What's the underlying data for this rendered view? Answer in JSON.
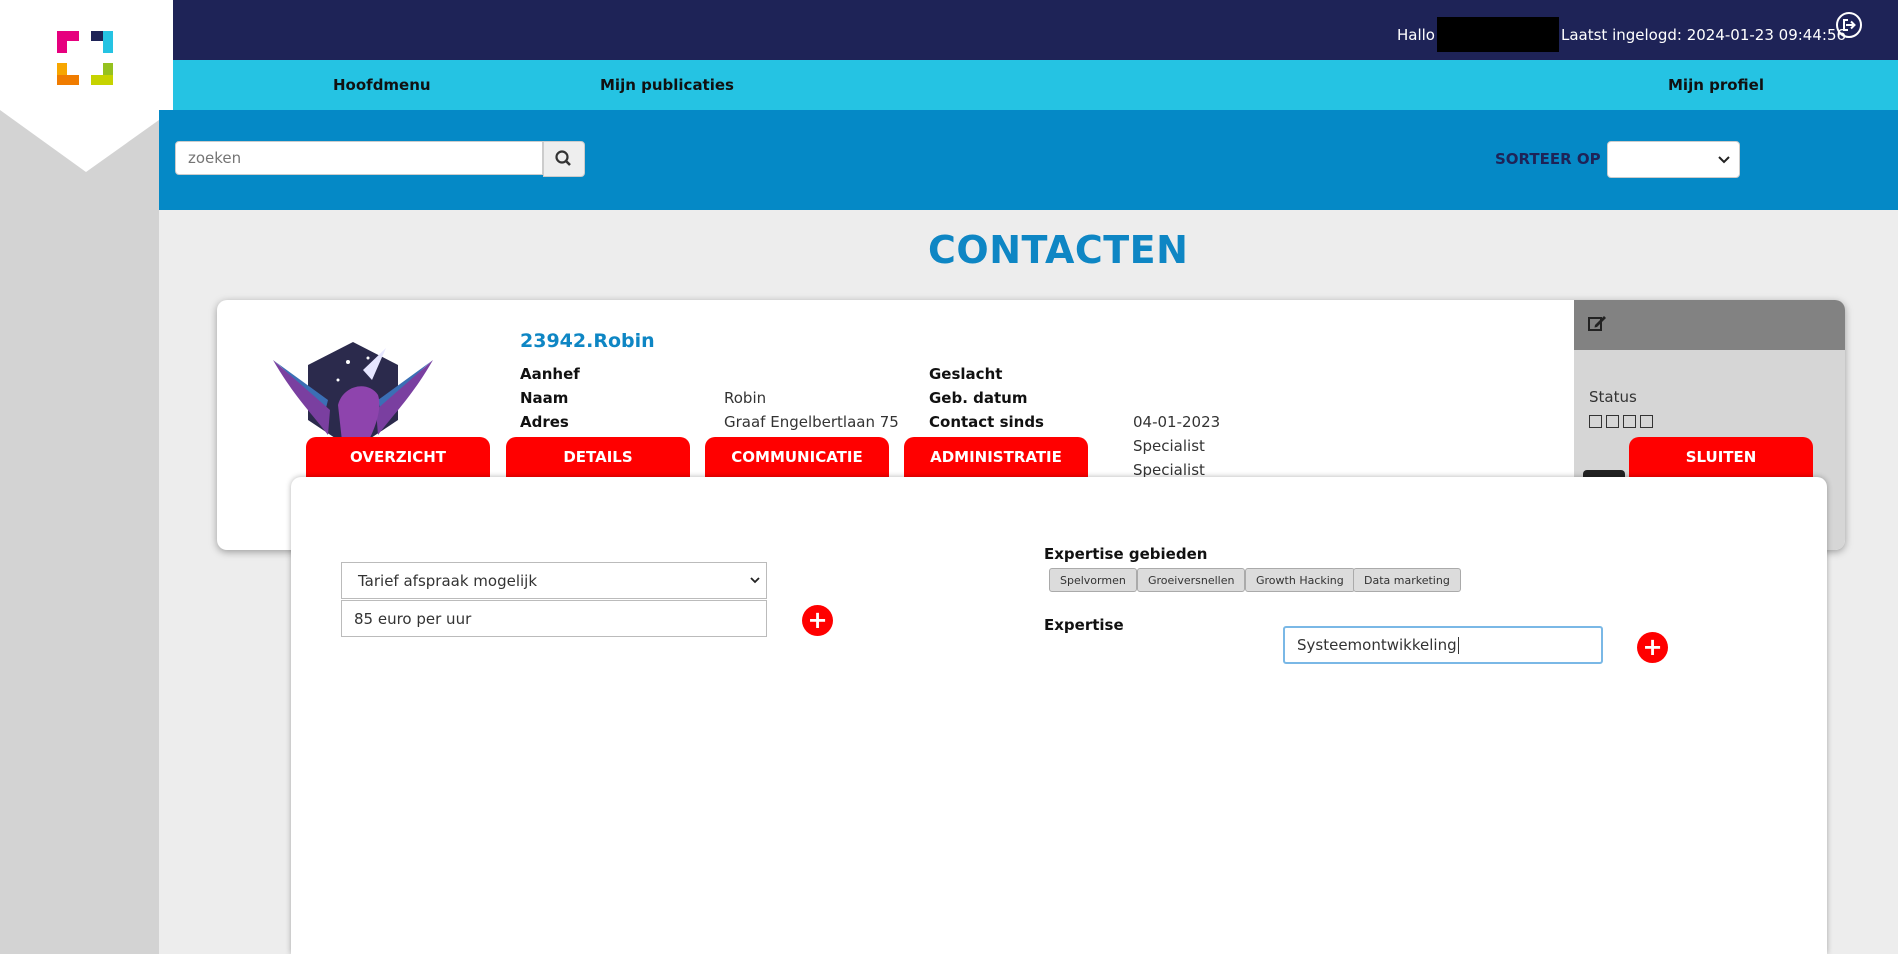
{
  "header": {
    "greeting": "Hallo",
    "last_login": "Laatst ingelogd: 2024-01-23 09:44:56"
  },
  "nav": {
    "main_menu": "Hoofdmenu",
    "my_publications": "Mijn publicaties",
    "my_profile": "Mijn profiel"
  },
  "search": {
    "placeholder": "zoeken",
    "sort_label": "SORTEER OP",
    "sort_value": ""
  },
  "page": {
    "title": "CONTACTEN"
  },
  "contact": {
    "name": "23942.Robin",
    "fields": {
      "aanhef_label": "Aanhef",
      "aanhef_value": "",
      "naam_label": "Naam",
      "naam_value": "Robin",
      "adres_label": "Adres",
      "adres_value": "Graaf Engelbertlaan 75",
      "geslacht_label": "Geslacht",
      "geslacht_value": "",
      "gebdatum_label": "Geb. datum",
      "gebdatum_value": "",
      "contact_sinds_label": "Contact sinds",
      "contact_sinds_value": "04-01-2023",
      "extra_1": "Specialist",
      "extra_2": "Specialist"
    },
    "status_label": "Status"
  },
  "tabs": {
    "overview": "OVERZICHT",
    "details": "DETAILS",
    "communication": "COMMUNICATIE",
    "administration": "ADMINISTRATIE",
    "close": "SLUITEN"
  },
  "detail": {
    "tariff_select": "Tarief afspraak mogelijk",
    "tariff_value": "85 euro per uur",
    "expertise_areas_label": "Expertise gebieden",
    "expertise_areas": [
      "Spelvormen",
      "Groeiversnellen",
      "Growth Hacking",
      "Data marketing"
    ],
    "expertise_label": "Expertise",
    "expertise_value": "Systeemontwikkeling"
  },
  "colors": {
    "topbar": "#1e2357",
    "navbar": "#25c3e3",
    "searchbar": "#0589c6",
    "accent_red": "#ff0000",
    "title_blue": "#0e86c4"
  },
  "icons": {
    "logout": "logout-icon",
    "search": "search-icon",
    "edit": "edit-icon",
    "add": "plus-icon"
  }
}
